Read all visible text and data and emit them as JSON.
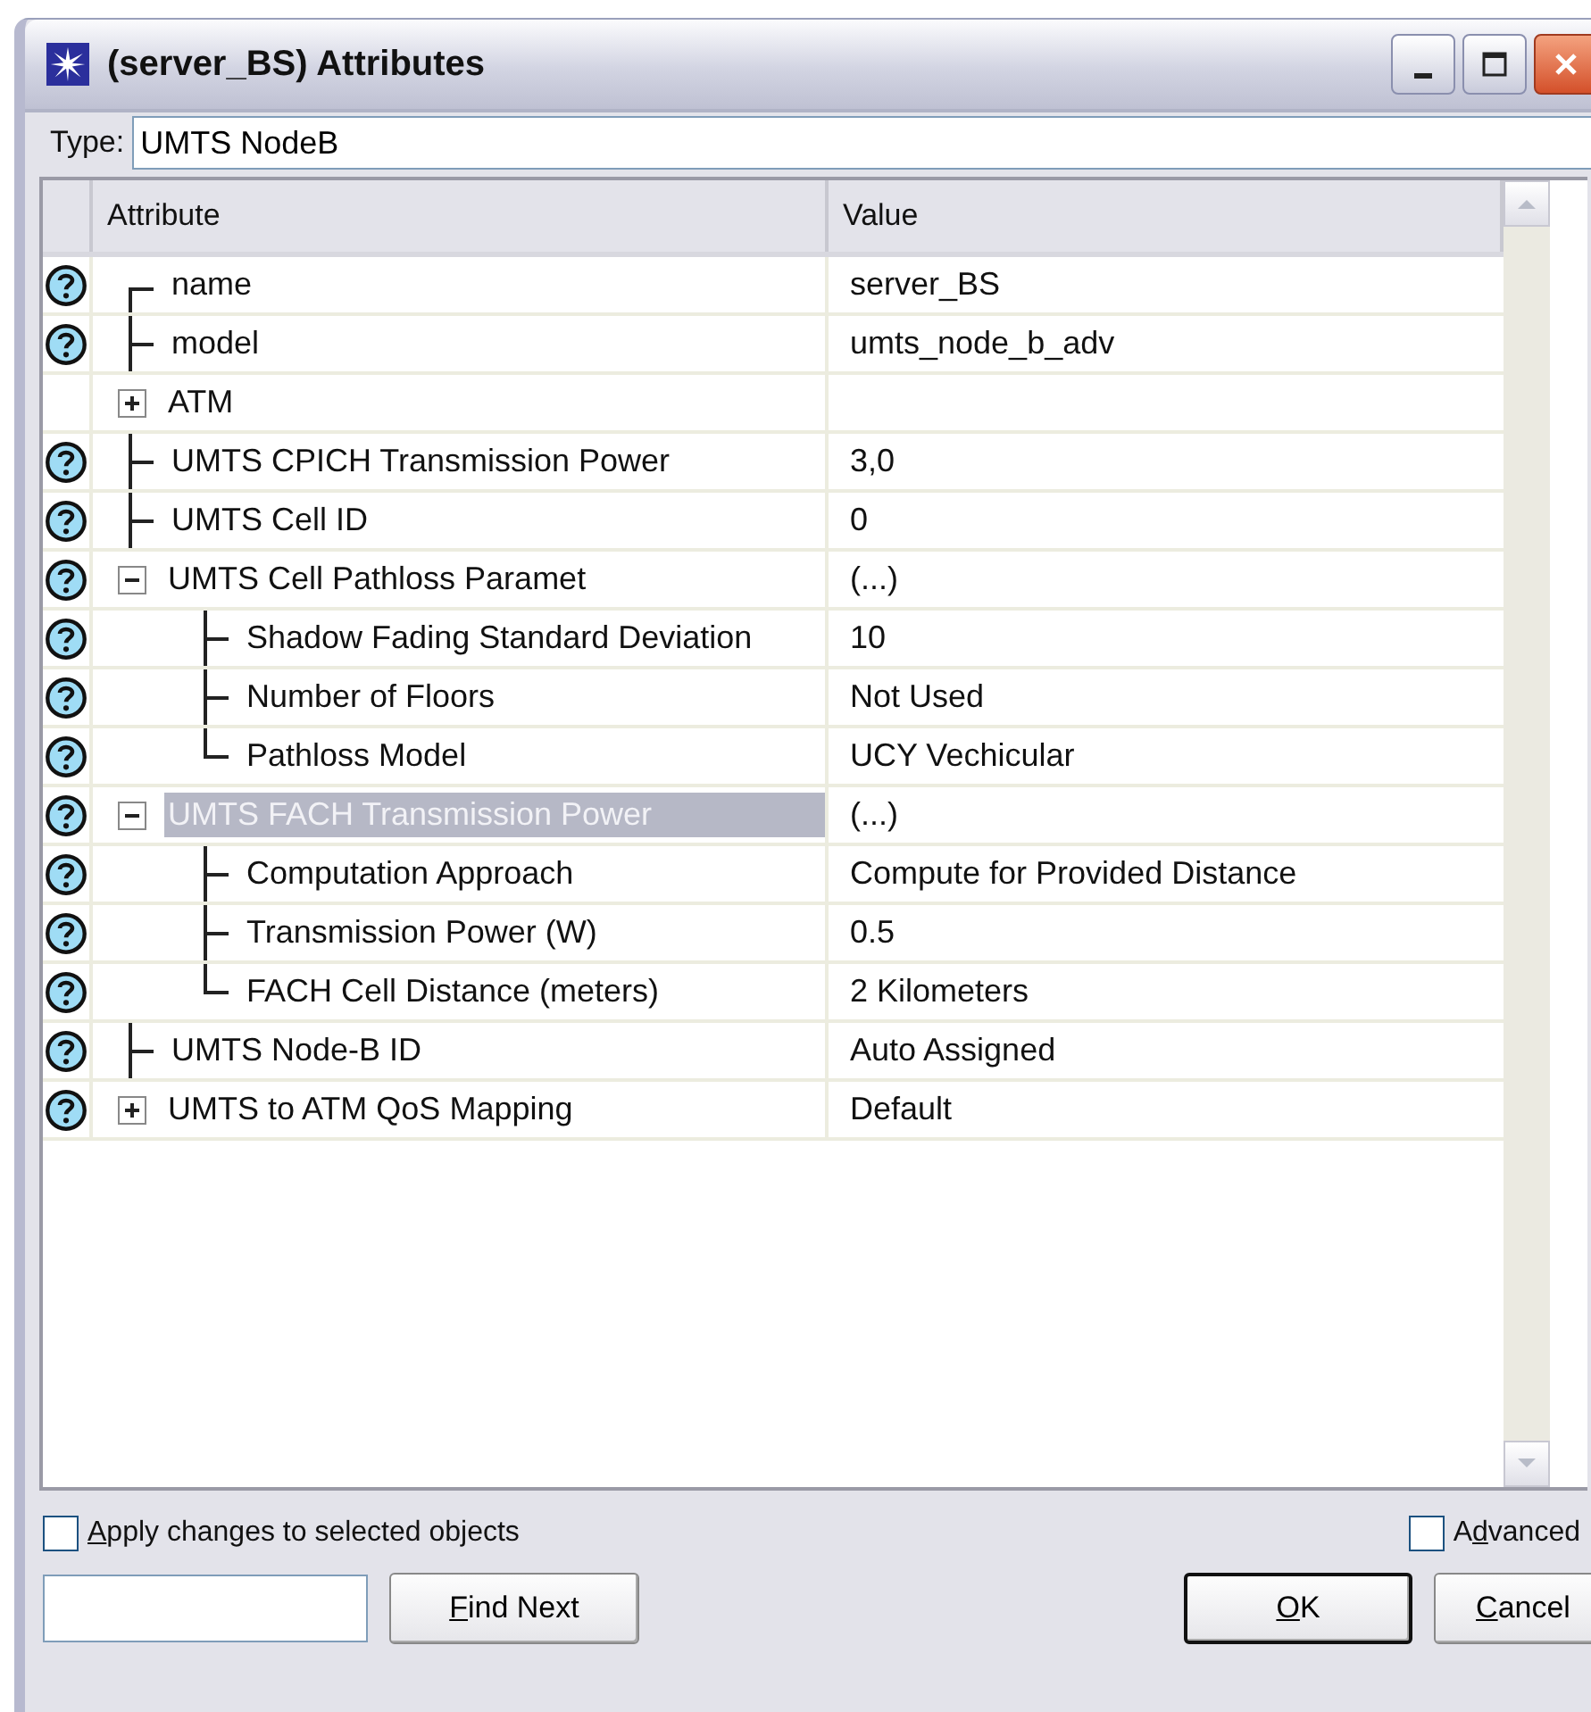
{
  "window": {
    "title": "(server_BS) Attributes"
  },
  "type_field": {
    "label": "Type:",
    "value": "UMTS NodeB"
  },
  "table": {
    "columns": [
      "Attribute",
      "Value"
    ],
    "rows": [
      {
        "label": "name",
        "value": "server_BS",
        "help": true,
        "selected": false
      },
      {
        "label": "model",
        "value": "umts_node_b_adv",
        "help": true,
        "selected": false
      },
      {
        "label": "ATM",
        "help": false,
        "selected": false,
        "expanded": false
      },
      {
        "label": "UMTS CPICH Transmission Power",
        "value": "3,0",
        "help": true,
        "selected": false
      },
      {
        "label": "UMTS Cell ID",
        "value": "0",
        "help": true,
        "selected": false
      },
      {
        "label": "UMTS Cell Pathloss Paramet",
        "value": "(...)",
        "help": true,
        "selected": false,
        "expanded": true,
        "children": [
          {
            "label": "Shadow Fading Standard Deviation",
            "value": "10",
            "help": true,
            "selected": false
          },
          {
            "label": "Number of Floors",
            "value": "Not Used",
            "help": true,
            "selected": false
          },
          {
            "label": "Pathloss Model",
            "value": "UCY Vechicular",
            "help": true,
            "selected": false
          }
        ]
      },
      {
        "label": "UMTS FACH Transmission Power",
        "value": "(...)",
        "help": true,
        "selected": true,
        "expanded": true,
        "children": [
          {
            "label": "Computation Approach",
            "value": "Compute for Provided Distance",
            "help": true,
            "selected": false
          },
          {
            "label": "Transmission Power (W)",
            "value": "0.5",
            "help": true,
            "selected": false
          },
          {
            "label": "FACH Cell Distance (meters)",
            "value": "2 Kilometers",
            "help": true,
            "selected": false
          }
        ]
      },
      {
        "label": "UMTS Node-B ID",
        "value": "Auto Assigned",
        "help": true,
        "selected": false
      },
      {
        "label": "UMTS to ATM QoS Mapping",
        "value": "Default",
        "help": true,
        "selected": false,
        "expanded": false
      }
    ]
  },
  "apply_checkbox": {
    "label": {
      "key": "A",
      "post": "pply changes to selected objects"
    },
    "checked": false
  },
  "advanced_checkbox": {
    "label": {
      "pre": "A",
      "key": "d",
      "post": "vanced"
    },
    "checked": false
  },
  "buttons": [
    {
      "kind": "find",
      "label": {
        "key": "F",
        "post": "ind Next"
      },
      "default": false
    },
    {
      "kind": "ok",
      "label": {
        "key": "O",
        "post": "K"
      },
      "default": true
    },
    {
      "kind": "cancel",
      "label": {
        "key": "C",
        "post": "ancel"
      },
      "default": false
    }
  ]
}
